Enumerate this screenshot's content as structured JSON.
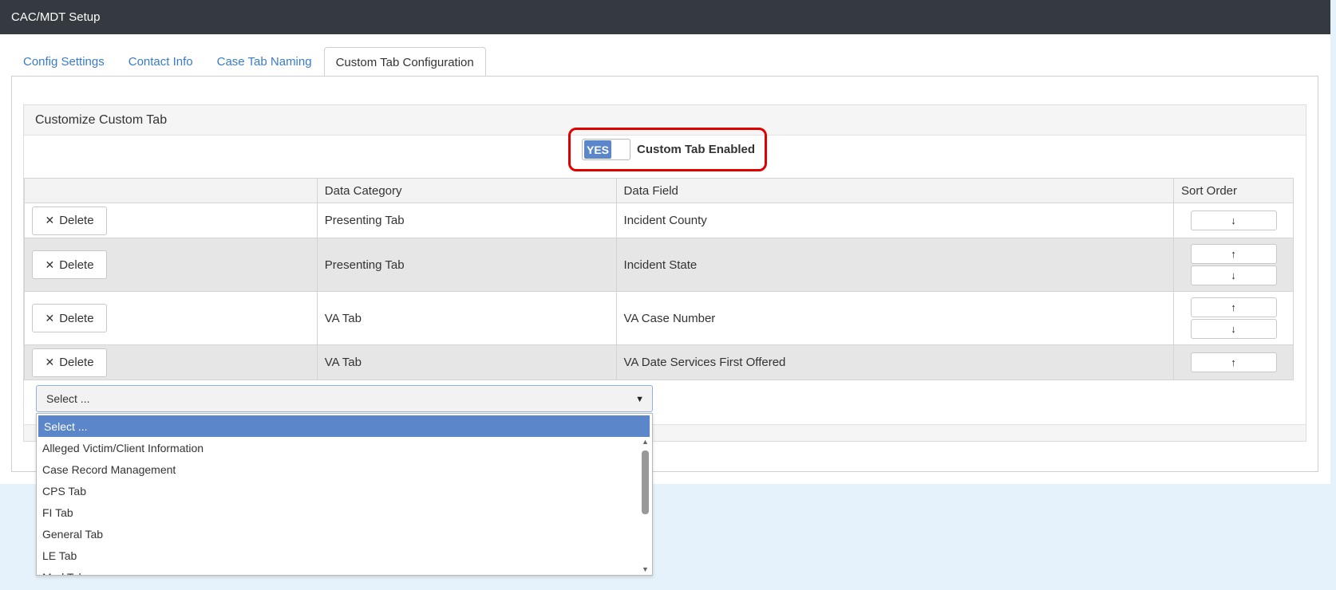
{
  "window": {
    "title": "CAC/MDT Setup"
  },
  "tabs": [
    {
      "label": "Config Settings"
    },
    {
      "label": "Contact Info"
    },
    {
      "label": "Case Tab Naming"
    },
    {
      "label": "Custom Tab Configuration"
    }
  ],
  "active_tab": "Custom Tab Configuration",
  "card": {
    "title": "Customize Custom Tab"
  },
  "toggle": {
    "state_label": "YES",
    "label": "Custom Tab Enabled",
    "enabled": true
  },
  "table": {
    "columns": [
      "",
      "Data Category",
      "Data Field",
      "Sort Order"
    ],
    "rows": [
      {
        "delete_label": "Delete",
        "category": "Presenting Tab",
        "field": "Incident County",
        "sort_up": false,
        "sort_down": true
      },
      {
        "delete_label": "Delete",
        "category": "Presenting Tab",
        "field": "Incident State",
        "sort_up": true,
        "sort_down": true
      },
      {
        "delete_label": "Delete",
        "category": "VA Tab",
        "field": "VA Case Number",
        "sort_up": true,
        "sort_down": true
      },
      {
        "delete_label": "Delete",
        "category": "VA Tab",
        "field": "VA Date Services First Offered",
        "sort_up": true,
        "sort_down": false
      }
    ]
  },
  "icons": {
    "delete": "close-icon",
    "up": "arrow-up-icon",
    "down": "arrow-down-icon"
  },
  "select": {
    "value": "Select ...",
    "options": [
      "Select ...",
      "Alleged Victim/Client Information",
      "Case Record Management",
      "CPS Tab",
      "FI Tab",
      "General Tab",
      "LE Tab",
      "Med Tab"
    ]
  },
  "colors": {
    "accent": "#5b86c9",
    "highlight_border": "#e00000",
    "titlebar": "#343a40"
  }
}
